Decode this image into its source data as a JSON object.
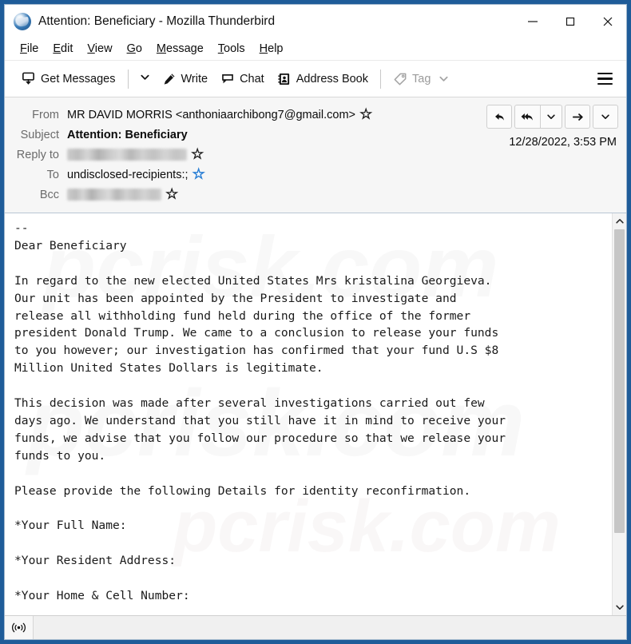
{
  "window": {
    "title": "Attention: Beneficiary - Mozilla Thunderbird",
    "logo_icon": "thunderbird-logo-icon",
    "controls": {
      "minimize": "minimize-icon",
      "maximize": "maximize-icon",
      "close": "close-icon"
    }
  },
  "menubar": {
    "items": [
      {
        "label": "File",
        "accel": "F"
      },
      {
        "label": "Edit",
        "accel": "E"
      },
      {
        "label": "View",
        "accel": "V"
      },
      {
        "label": "Go",
        "accel": "G"
      },
      {
        "label": "Message",
        "accel": "M"
      },
      {
        "label": "Tools",
        "accel": "T"
      },
      {
        "label": "Help",
        "accel": "H"
      }
    ]
  },
  "toolbar": {
    "get_messages_label": "Get Messages",
    "get_messages_icon": "get-messages-icon",
    "get_messages_caret_icon": "chevron-down-icon",
    "write_label": "Write",
    "write_icon": "pencil-icon",
    "chat_label": "Chat",
    "chat_icon": "chat-bubble-icon",
    "address_book_label": "Address Book",
    "address_book_icon": "address-book-icon",
    "tag_label": "Tag",
    "tag_icon": "tag-icon",
    "tag_caret_icon": "chevron-down-icon",
    "tag_disabled": true,
    "app_menu_icon": "hamburger-menu-icon"
  },
  "message_header": {
    "from_label": "From",
    "from_value": "MR DAVID MORRIS <anthoniaarchibong7@gmail.com>",
    "subject_label": "Subject",
    "subject_value": "Attention: Beneficiary",
    "reply_to_label": "Reply to",
    "reply_to_value": "",
    "reply_to_redacted": true,
    "to_label": "To",
    "to_value": "undisclosed-recipients:;",
    "bcc_label": "Bcc",
    "bcc_value": "",
    "bcc_redacted": true,
    "date": "12/28/2022, 3:53 PM",
    "star_icon": "star-icon",
    "actions": [
      {
        "name": "reply-button",
        "icon": "reply-arrow-icon"
      },
      {
        "name": "reply-all-button",
        "icon": "reply-all-arrow-icon"
      },
      {
        "name": "reply-all-dropdown",
        "icon": "chevron-down-icon"
      },
      {
        "name": "forward-button",
        "icon": "forward-arrow-icon"
      },
      {
        "name": "more-actions-dropdown",
        "icon": "chevron-down-icon"
      }
    ]
  },
  "message_body": {
    "text": "--\nDear Beneficiary\n\nIn regard to the new elected United States Mrs kristalina Georgieva.\nOur unit has been appointed by the President to investigate and\nrelease all withholding fund held during the office of the former\npresident Donald Trump. We came to a conclusion to release your funds\nto you however; our investigation has confirmed that your fund U.S $8\nMillion United States Dollars is legitimate.\n\nThis decision was made after several investigations carried out few\ndays ago. We understand that you still have it in mind to receive your\nfunds, we advise that you follow our procedure so that we release your\nfunds to you.\n\nPlease provide the following Details for identity reconfirmation.\n\n*Your Full Name:\n\n*Your Resident Address:\n\n*Your Home & Cell Number:",
    "watermark": "pcrisk.com",
    "scroll_up_icon": "chevron-up-icon",
    "scroll_down_icon": "chevron-down-icon"
  },
  "statusbar": {
    "icon": "broadcast-icon",
    "text": ""
  },
  "colors": {
    "window_border": "#1f5c99",
    "header_bg": "#f6f6f6",
    "accent_blue": "#2b7fd4",
    "text": "#0b0b0b",
    "muted_text": "#6b6b6b"
  }
}
